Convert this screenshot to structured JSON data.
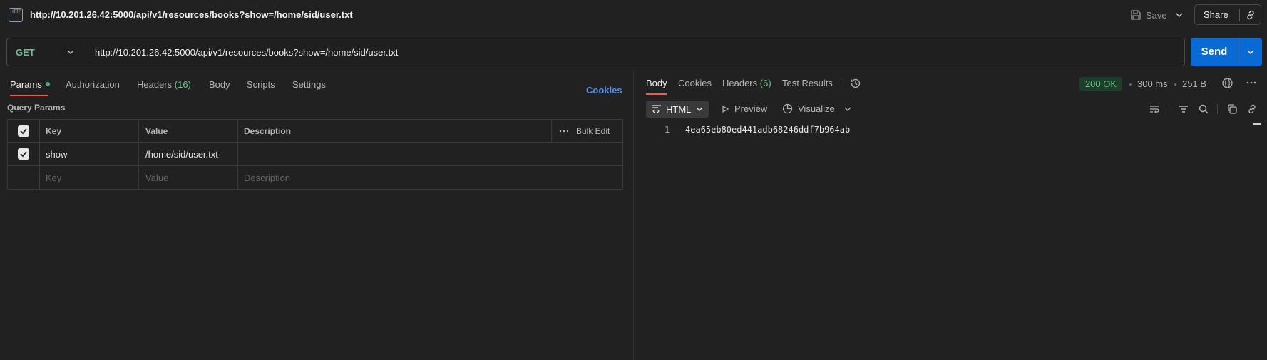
{
  "topbar": {
    "icon_label": "HTTP",
    "title": "http://10.201.26.42:5000/api/v1/resources/books?show=/home/sid/user.txt",
    "save_label": "Save",
    "share_label": "Share"
  },
  "request": {
    "method": "GET",
    "url": "http://10.201.26.42:5000/api/v1/resources/books?show=/home/sid/user.txt",
    "send_label": "Send"
  },
  "request_tabs": [
    {
      "label": "Params",
      "active": true
    },
    {
      "label": "Authorization"
    },
    {
      "label": "Headers",
      "count": "(16)"
    },
    {
      "label": "Body"
    },
    {
      "label": "Scripts"
    },
    {
      "label": "Settings"
    }
  ],
  "cookies_label": "Cookies",
  "query_params": {
    "title": "Query Params",
    "headers": {
      "key": "Key",
      "value": "Value",
      "description": "Description",
      "bulk_edit": "Bulk Edit"
    },
    "rows": [
      {
        "checked": true,
        "key": "show",
        "value": "/home/sid/user.txt",
        "description": ""
      }
    ],
    "placeholder": {
      "key": "Key",
      "value": "Value",
      "description": "Description"
    }
  },
  "response_tabs": [
    {
      "label": "Body",
      "active": true
    },
    {
      "label": "Cookies"
    },
    {
      "label": "Headers",
      "count": "(6)"
    },
    {
      "label": "Test Results"
    }
  ],
  "response_meta": {
    "status": "200 OK",
    "time": "300 ms",
    "size": "251 B"
  },
  "response_toolbar": {
    "format": "HTML",
    "preview": "Preview",
    "visualize": "Visualize"
  },
  "response_body": {
    "line_number": "1",
    "content": "4ea65eb80ed441adb68246ddf7b964ab"
  },
  "colors": {
    "background": "#212121",
    "accent_send": "#0a6ad3",
    "method_get": "#6ac38e",
    "active_tab_underline": "#ef5f3b",
    "cookies_link": "#4f94e8",
    "status_ok": "#55c882"
  },
  "icons": [
    "http-file-icon",
    "save-icon",
    "chevron-down-icon",
    "link-icon",
    "history-icon",
    "globe-icon",
    "more-icon",
    "wrap-lines-icon",
    "filter-icon",
    "search-icon",
    "copy-icon",
    "link-copy-icon",
    "preview-play-icon",
    "visualize-icon",
    "format-icon",
    "checkbox-icon",
    "ellipsis-icon"
  ]
}
